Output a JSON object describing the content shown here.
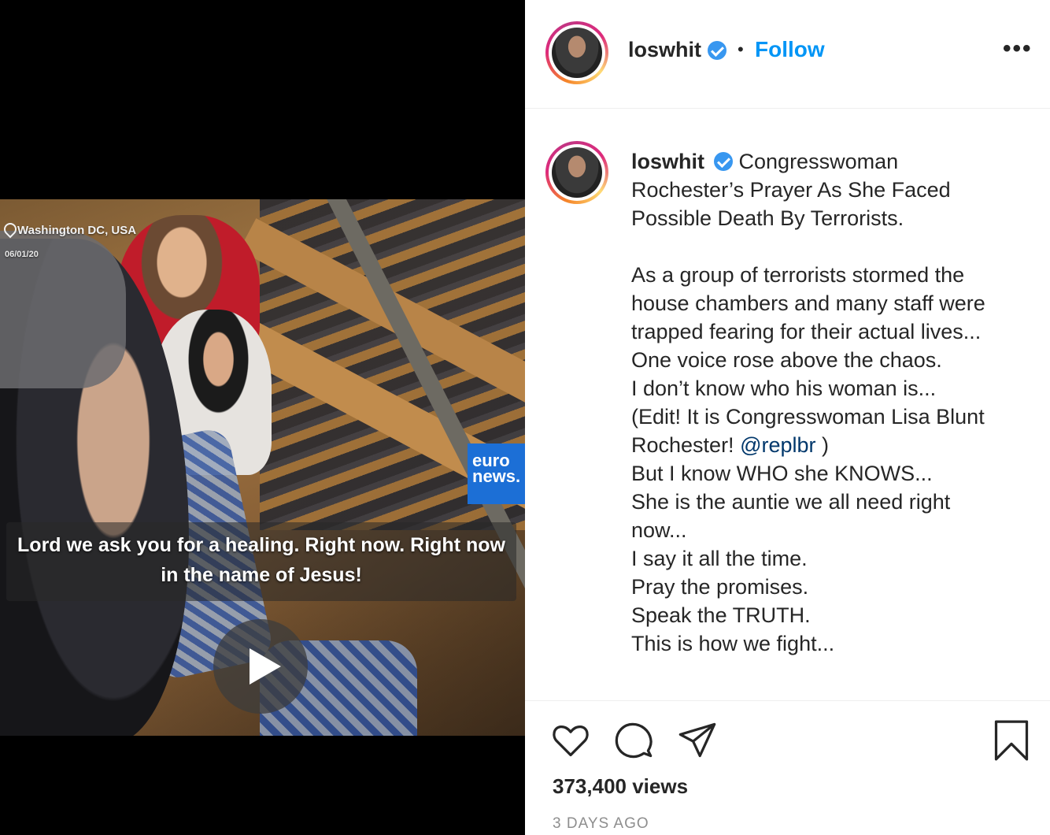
{
  "video": {
    "location": "Washington DC, USA",
    "date": "06/01/20",
    "watermark": "euro news.",
    "caption": "Lord we ask you for a healing. Right now. Right now in the name of Jesus!"
  },
  "header": {
    "username": "loswhit",
    "separator": "•",
    "follow_label": "Follow",
    "more_label": "•••"
  },
  "post": {
    "username": "loswhit",
    "lines_a": [
      "Congresswoman",
      "Rochester’s Prayer As She Faced",
      "Possible Death By Terrorists."
    ],
    "lines_b": [
      "As a group of terrorists stormed the",
      "house chambers and many staff were",
      "trapped fearing for their actual lives...",
      "One voice rose above the chaos.",
      "I don’t know who his woman is...",
      "(Edit! It is Congresswoman Lisa Blunt"
    ],
    "mention_prefix": "Rochester! ",
    "mention": "@replbr",
    "mention_suffix": " )",
    "lines_c": [
      "But I know WHO she KNOWS...",
      "She is the auntie we all need right",
      "now...",
      "I say it all the time.",
      "Pray the promises.",
      "Speak the TRUTH.",
      "This is how we fight..."
    ]
  },
  "stats": {
    "views": "373,400 views",
    "time": "3 DAYS AGO"
  },
  "colors": {
    "accent": "#0095f6",
    "verified": "#3897f0",
    "mention": "#00376b",
    "muted": "#8e8e8e"
  },
  "icons": {
    "like": "heart-icon",
    "comment": "speech-bubble-icon",
    "share": "paper-plane-icon",
    "save": "bookmark-icon",
    "verified": "verified-badge-icon",
    "play": "play-icon",
    "location": "location-pin-icon"
  }
}
